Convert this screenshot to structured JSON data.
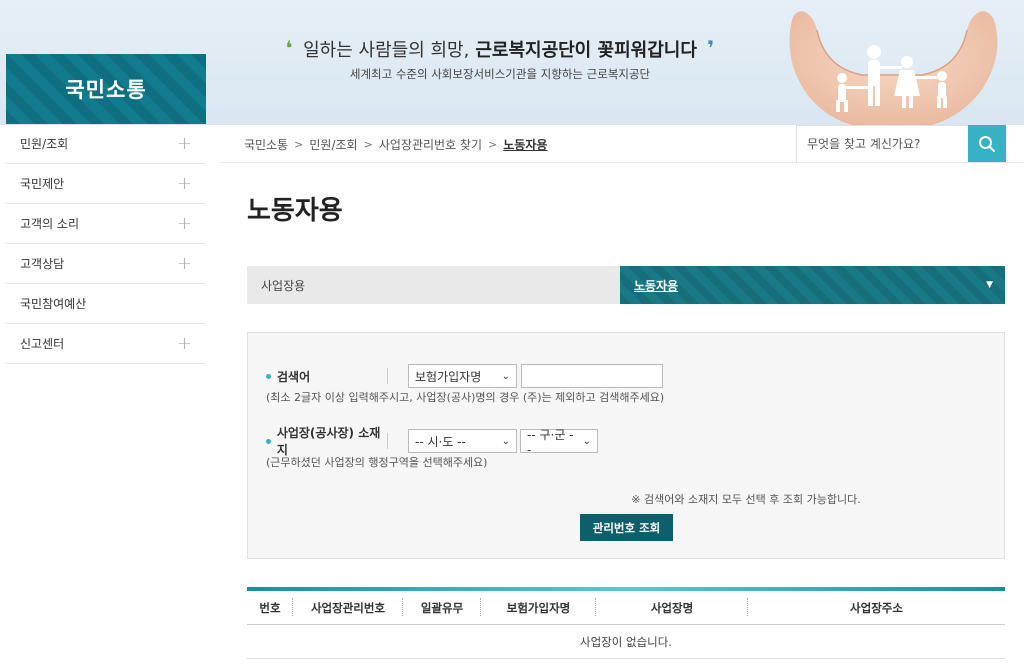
{
  "header": {
    "brand": "국민소통",
    "slogan_prefix": "일하는 사람들의 희망,",
    "slogan_strong": "근로복지공단이 꽃피워갑니다",
    "slogan_sub": "세계최고 수준의 사회보장서비스기관을 지향하는 근로복지공단"
  },
  "search": {
    "placeholder": "무엇을 찾고 계신가요?",
    "icon": "search-icon"
  },
  "breadcrumb": {
    "items": [
      "국민소통",
      "민원/조회",
      "사업장관리번호 찾기"
    ],
    "current": "노동자용",
    "separator": ">"
  },
  "sidebar": {
    "items": [
      {
        "label": "민원/조회",
        "expand": "+"
      },
      {
        "label": "국민제안",
        "expand": "+"
      },
      {
        "label": "고객의 소리",
        "expand": "+"
      },
      {
        "label": "고객상담",
        "expand": "+"
      },
      {
        "label": "국민참여예산",
        "expand": ""
      },
      {
        "label": "신고센터",
        "expand": "+"
      }
    ]
  },
  "main": {
    "title": "노동자용",
    "tabs": [
      {
        "label": "사업장용",
        "active": false
      },
      {
        "label": "노동자용",
        "active": true
      }
    ],
    "form": {
      "keyword_label": "검색어",
      "keyword_select": "보험가입자명",
      "keyword_value": "",
      "keyword_help": "(최소 2글자 이상 입력해주시고, 사업장(공사)명의 경우 (주)는 제외하고 검색해주세요)",
      "location_label": "사업장(공사장) 소재지",
      "sido_select": "-- 시·도 --",
      "gugun_select": "-- 구·군 --",
      "location_help": "(근무하셨던 사업장의 행정구역을 선택해주세요)",
      "notice": "※ 검색어와 소재지 모두 선택 후 조회 가능합니다.",
      "submit_label": "관리번호 조회"
    },
    "table": {
      "columns": [
        "번호",
        "사업장관리번호",
        "일괄유무",
        "보험가입자명",
        "사업장명",
        "사업장주소"
      ],
      "empty_message": "사업장이 없습니다."
    }
  },
  "colors": {
    "teal_dark": "#0d5f6b",
    "teal": "#35b2c4",
    "brand_bg": "#137b8e"
  }
}
